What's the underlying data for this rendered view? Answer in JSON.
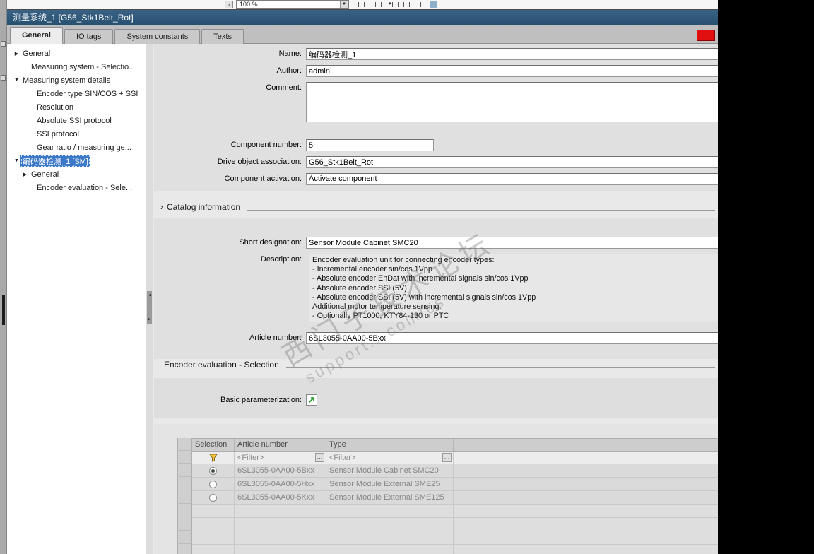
{
  "mini_toolbar": {
    "zoom_value": "100 %"
  },
  "window": {
    "title": "测量系统_1 [G56_Stk1Belt_Rot]"
  },
  "tabs": {
    "items": [
      {
        "label": "General",
        "active": true
      },
      {
        "label": "IO tags",
        "active": false
      },
      {
        "label": "System constants",
        "active": false
      },
      {
        "label": "Texts",
        "active": false
      }
    ]
  },
  "tree": {
    "items": [
      {
        "label": "General",
        "arrow": "right",
        "indent": 0,
        "selected": false
      },
      {
        "label": "Measuring system - Selectio...",
        "arrow": "none",
        "indent": 1,
        "selected": false
      },
      {
        "label": "Measuring system details",
        "arrow": "down",
        "indent": 0,
        "selected": false
      },
      {
        "label": "Encoder type SIN/COS + SSI",
        "arrow": "none",
        "indent": 2,
        "selected": false
      },
      {
        "label": "Resolution",
        "arrow": "none",
        "indent": 2,
        "selected": false
      },
      {
        "label": "Absolute SSI protocol",
        "arrow": "none",
        "indent": 2,
        "selected": false
      },
      {
        "label": "SSI protocol",
        "arrow": "none",
        "indent": 2,
        "selected": false
      },
      {
        "label": "Gear ratio / measuring ge...",
        "arrow": "none",
        "indent": 2,
        "selected": false
      },
      {
        "label": "编码器检测_1 [SM]",
        "arrow": "down",
        "indent": 0,
        "selected": true
      },
      {
        "label": "General",
        "arrow": "right",
        "indent": 1,
        "selected": false
      },
      {
        "label": "Encoder evaluation - Sele...",
        "arrow": "none",
        "indent": 2,
        "selected": false
      }
    ]
  },
  "form": {
    "name_label": "Name:",
    "name_value": "编码器检测_1",
    "author_label": "Author:",
    "author_value": "admin",
    "comment_label": "Comment:",
    "comment_value": "",
    "component_number_label": "Component number:",
    "component_number_value": "5",
    "drive_object_label": "Drive object association:",
    "drive_object_value": "G56_Stk1Belt_Rot",
    "component_activation_label": "Component activation:",
    "component_activation_value": "Activate component"
  },
  "catalog": {
    "section_title": "Catalog information",
    "short_designation_label": "Short designation:",
    "short_designation_value": "Sensor Module Cabinet SMC20",
    "description_label": "Description:",
    "description_lines": [
      "Encoder evaluation unit for connecting encoder types:",
      "- Incremental encoder sin/cos 1Vpp",
      "- Absolute encoder EnDat with incremental signals sin/cos 1Vpp",
      "- Absolute encoder SSI (5V)",
      "- Absolute encoder SSI (5V) with incremental signals sin/cos 1Vpp",
      "Additional motor temperature sensing:",
      "- Optionally PT1000, KTY84-130 or PTC"
    ],
    "article_number_label": "Article number:",
    "article_number_value": "6SL3055-0AA00-5Bxx"
  },
  "selection_section": {
    "title": "Encoder evaluation - Selection",
    "basic_param_label": "Basic parameterization:"
  },
  "table": {
    "columns": [
      "Selection",
      "Article number",
      "Type"
    ],
    "filter_placeholder": "<Filter>",
    "rows": [
      {
        "selected": true,
        "article": "6SL3055-0AA00-5Bxx",
        "type": "Sensor Module Cabinet SMC20"
      },
      {
        "selected": false,
        "article": "6SL3055-0AA00-5Hxx",
        "type": "Sensor Module External SME25"
      },
      {
        "selected": false,
        "article": "6SL3055-0AA00-5Kxx",
        "type": "Sensor Module External SME125"
      }
    ]
  },
  "watermark": {
    "line1": "西门子技术论坛",
    "line2": "support...com/cs"
  },
  "colors": {
    "selection_blue": "#3c78c8",
    "error_badge_red": "#e01010",
    "funnel_yellow": "#f5c33b",
    "basic_param_green": "#1d9a1d",
    "titlebar_blue": "#2d5777"
  }
}
